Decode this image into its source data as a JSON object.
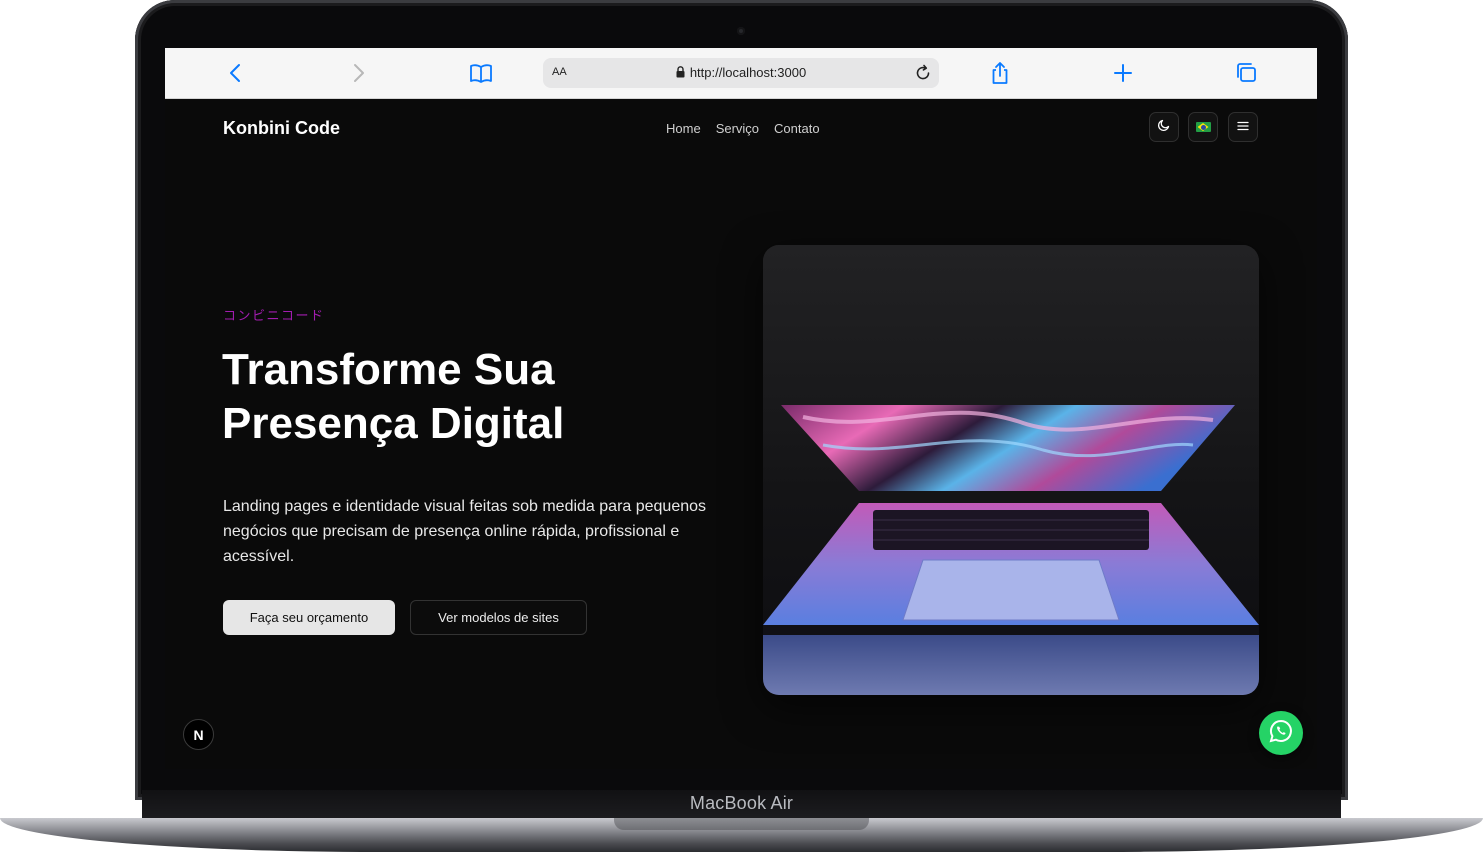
{
  "device": {
    "label": "MacBook Air"
  },
  "browser": {
    "text_size_label": "AA",
    "url": "http://localhost:3000",
    "buttons": {
      "back": "chevron-left-icon",
      "forward": "chevron-right-icon",
      "bookmarks": "book-icon",
      "reload": "reload-icon",
      "share": "share-icon",
      "new_tab": "plus-icon",
      "tabs": "tabs-icon"
    }
  },
  "site": {
    "brand": "Konbini Code",
    "nav": [
      "Home",
      "Serviço",
      "Contato"
    ],
    "controls": {
      "theme_toggle": "moon-icon",
      "language": "brazil-flag-icon",
      "menu": "hamburger-menu-icon"
    },
    "hero": {
      "eyebrow": "コンビニコード",
      "title_line1": "Transforme Sua",
      "title_line2": "Presença Digital",
      "description": "Landing pages e identidade visual feitas sob medida para pequenos negócios que precisam de presença online rápida, profissional e acessível.",
      "cta_primary": "Faça seu orçamento",
      "cta_secondary": "Ver modelos de sites",
      "image": "laptop-photo"
    },
    "dev_indicator": "N",
    "whatsapp": "whatsapp-icon",
    "colors": {
      "background": "#0a0a0a",
      "accent_eyebrow": "#a21caf",
      "whatsapp_green": "#25d366",
      "primary_button": "#e6e6e6"
    }
  }
}
